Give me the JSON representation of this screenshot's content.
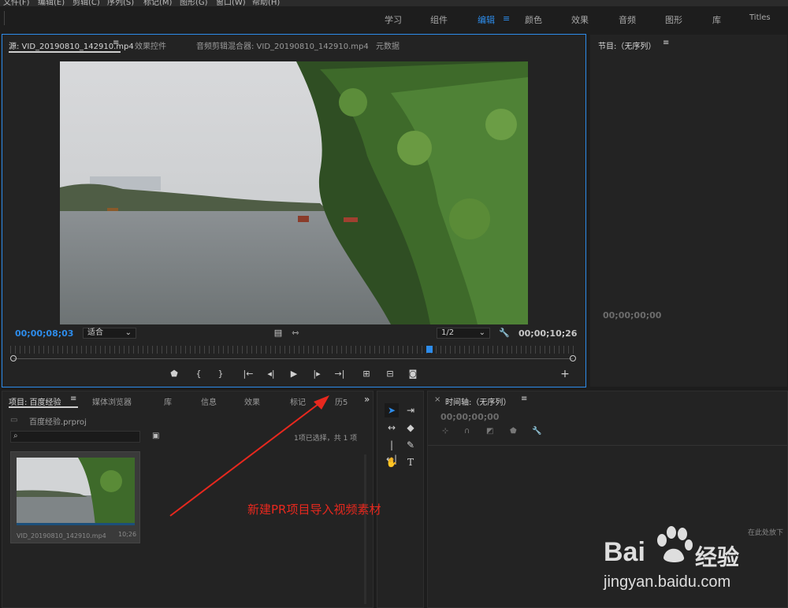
{
  "menu": [
    "文件(F)",
    "编辑(E)",
    "剪辑(C)",
    "序列(S)",
    "标记(M)",
    "图形(G)",
    "窗口(W)",
    "帮助(H)"
  ],
  "workspaces": {
    "items": [
      "学习",
      "组件",
      "编辑",
      "颜色",
      "效果",
      "音频",
      "图形",
      "库",
      "Titles"
    ],
    "active": "编辑",
    "menu_icon": "≡"
  },
  "source_panel": {
    "tabs": [
      "源: VID_20190810_142910.mp4",
      "效果控件",
      "音频剪辑混合器: VID_20190810_142910.mp4",
      "元数据"
    ],
    "menu_icon": "≡",
    "timecode_in": "00;00;08;03",
    "fit": "适合",
    "resolution": "1/2",
    "timecode_duration": "00;00;10;26",
    "playhead_fraction": 0.744
  },
  "program_panel": {
    "title": "节目:（无序列）",
    "menu_icon": "≡",
    "timecode": "00;00;00;00"
  },
  "project_panel": {
    "tabs": [
      "项目: 百度经验",
      "媒体浏览器",
      "库",
      "信息",
      "效果",
      "标记",
      "历5"
    ],
    "menu_icon": "≡",
    "overflow": "»",
    "project_file": "百度经验.prproj",
    "status": "1项已选择，共 1 项",
    "clip_name": "VID_20190810_142910.mp4",
    "clip_duration": "10;26"
  },
  "timeline_panel": {
    "close": "×",
    "title": "时间轴:（无序列）",
    "menu_icon": "≡",
    "timecode": "00;00;00;00",
    "drop_hint": "在此处放下"
  },
  "annotation": {
    "text": "新建PR项目导入视频素材",
    "color": "#e8281e"
  },
  "watermark": {
    "logo": "Bai",
    "logo2": "经验",
    "url": "jingyan.baidu.com"
  }
}
